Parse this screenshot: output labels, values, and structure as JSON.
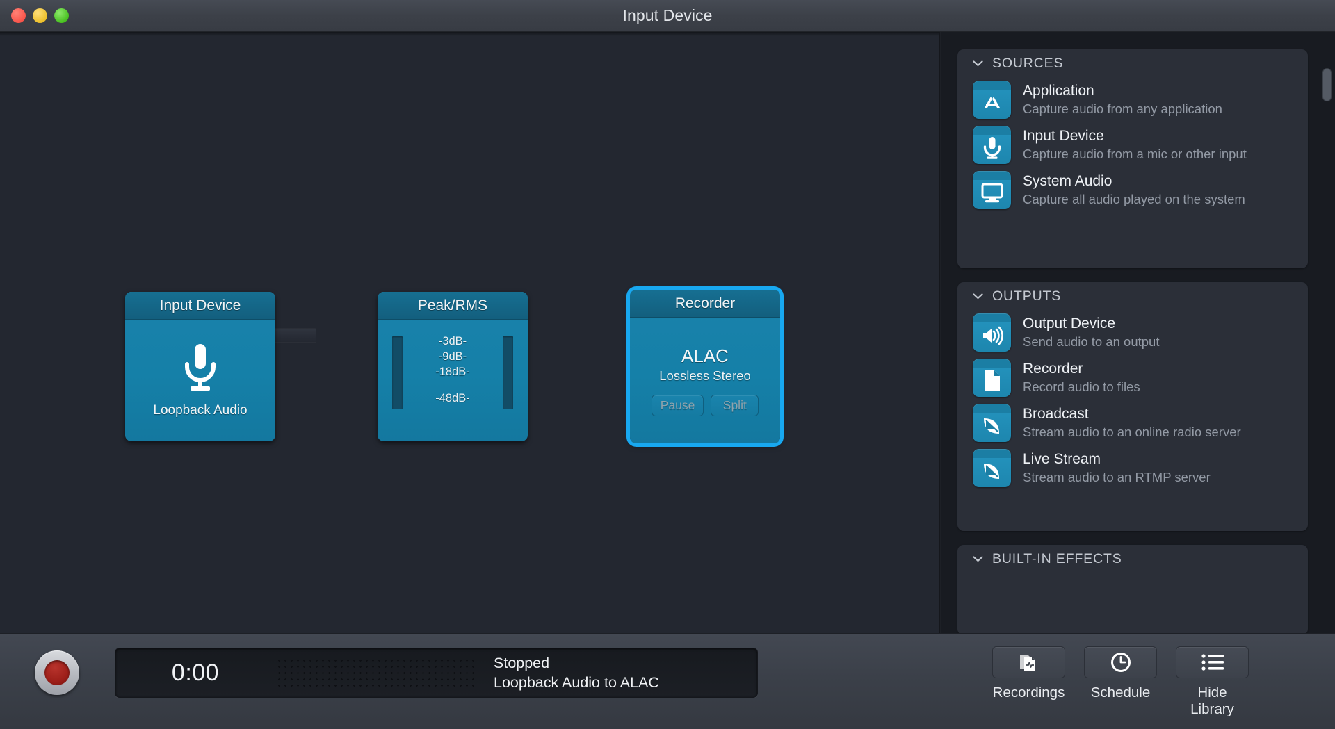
{
  "window": {
    "title": "Input Device",
    "traffic_lights": [
      {
        "name": "close-button",
        "color": "#f9554b"
      },
      {
        "name": "minimize-button",
        "color": "#edc02c"
      },
      {
        "name": "zoom-button",
        "color": "#49c121"
      }
    ]
  },
  "canvas": {
    "nodes": [
      {
        "id": "input-device",
        "title": "Input Device",
        "icon": "microphone-icon",
        "label": "Loopback Audio",
        "selected": false
      },
      {
        "id": "peak-rms",
        "title": "Peak/RMS",
        "icon": "level-meter-icon",
        "scale": [
          "-3dB-",
          "-9dB-",
          "-18dB-",
          "-48dB-"
        ],
        "selected": false
      },
      {
        "id": "recorder",
        "title": "Recorder",
        "format": "ALAC",
        "subtitle": "Lossless Stereo",
        "buttons": [
          {
            "name": "pause-button",
            "label": "Pause"
          },
          {
            "name": "split-button",
            "label": "Split"
          }
        ],
        "selected": true
      }
    ]
  },
  "sidebar": {
    "sections": [
      {
        "id": "sources",
        "header": "SOURCES",
        "collapsed": false,
        "items": [
          {
            "icon": "application-icon",
            "title": "Application",
            "desc": "Capture audio from any application"
          },
          {
            "icon": "microphone-icon",
            "title": "Input Device",
            "desc": "Capture audio from a mic or other input"
          },
          {
            "icon": "display-icon",
            "title": "System Audio",
            "desc": "Capture all audio played on the system"
          }
        ]
      },
      {
        "id": "outputs",
        "header": "OUTPUTS",
        "collapsed": false,
        "items": [
          {
            "icon": "speaker-icon",
            "title": "Output Device",
            "desc": "Send audio to an output"
          },
          {
            "icon": "file-icon",
            "title": "Recorder",
            "desc": "Record audio to files"
          },
          {
            "icon": "satellite-dish-icon",
            "title": "Broadcast",
            "desc": "Stream audio to an online radio server"
          },
          {
            "icon": "satellite-dish-icon",
            "title": "Live Stream",
            "desc": "Stream audio to an RTMP server"
          }
        ]
      },
      {
        "id": "built-in-effects",
        "header": "BUILT-IN EFFECTS",
        "collapsed": false,
        "items": []
      }
    ]
  },
  "toolbar": {
    "record_button": "record-button",
    "timer": "0:00",
    "status_line1": "Stopped",
    "status_line2": "Loopback Audio to ALAC",
    "buttons": [
      {
        "name": "recordings-button",
        "icon": "recordings-icon",
        "label": "Recordings"
      },
      {
        "name": "schedule-button",
        "icon": "clock-icon",
        "label": "Schedule"
      },
      {
        "name": "hide-library-button",
        "icon": "list-icon",
        "label": "Hide Library"
      }
    ]
  },
  "colors": {
    "accent": "#18a8f0",
    "node": "#1580a8",
    "panel": "#2b2f38",
    "record": "#9d1f19"
  }
}
